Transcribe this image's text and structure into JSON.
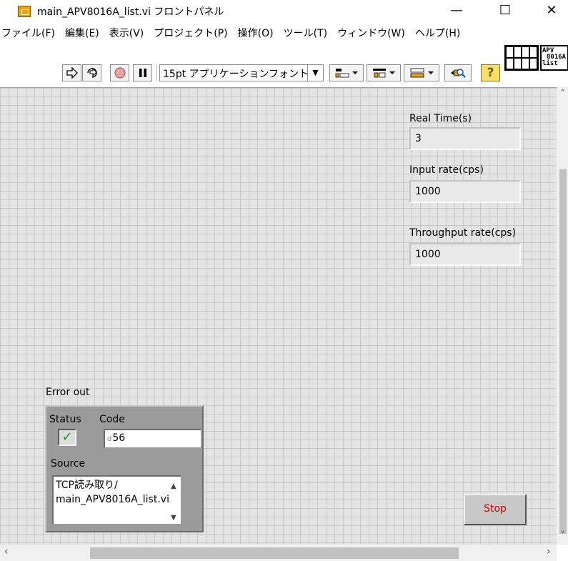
{
  "window": {
    "title": "main_APV8016A_list.vi フロントパネル",
    "minimize_glyph": "—",
    "maximize_glyph": "☐",
    "close_glyph": "✕"
  },
  "menu": [
    "ファイル(F)",
    "編集(E)",
    "表示(V)",
    "プロジェクト(P)",
    "操作(O)",
    "ツール(T)",
    "ウィンドウ(W)",
    "ヘルプ(H)"
  ],
  "toolbar": {
    "run_icon": "run-arrow-icon",
    "run_continuous_icon": "run-continuously-icon",
    "abort_icon": "abort-icon",
    "pause_icon": "pause-icon",
    "font": "15pt アプリケーションフォント",
    "align_icon": "align-objects-icon",
    "distribute_icon": "distribute-objects-icon",
    "resize_icon": "resize-objects-icon",
    "reorder_icon": "reorder-icon",
    "search_icon": "search-icon",
    "help_icon": "context-help-icon"
  },
  "vi_icon": {
    "line1": "APV",
    "line2": "8016A",
    "line3": "list"
  },
  "panel": {
    "real_time": {
      "label": "Real Time(s)",
      "value": "3"
    },
    "input_rate": {
      "label": "Input rate(cps)",
      "value": "1000"
    },
    "throughput_rate": {
      "label": "Throughput rate(cps)",
      "value": "1000"
    },
    "error_out": {
      "label": "Error out",
      "status_label": "Status",
      "status_icon": "check-mark-icon",
      "status_ok": true,
      "code_label": "Code",
      "code_radix": "d",
      "code_value": "56",
      "source_label": "Source",
      "source_line1": "TCP読み取り/",
      "source_line2": "main_APV8016A_list.vi"
    },
    "stop_button": "Stop"
  },
  "colors": {
    "panel_bg": "#e4e4e4",
    "grid_line": "#c9c9c9",
    "cluster_bg": "#9b9b9b",
    "stop_text": "#d40000",
    "status_ok": "#18a018"
  }
}
